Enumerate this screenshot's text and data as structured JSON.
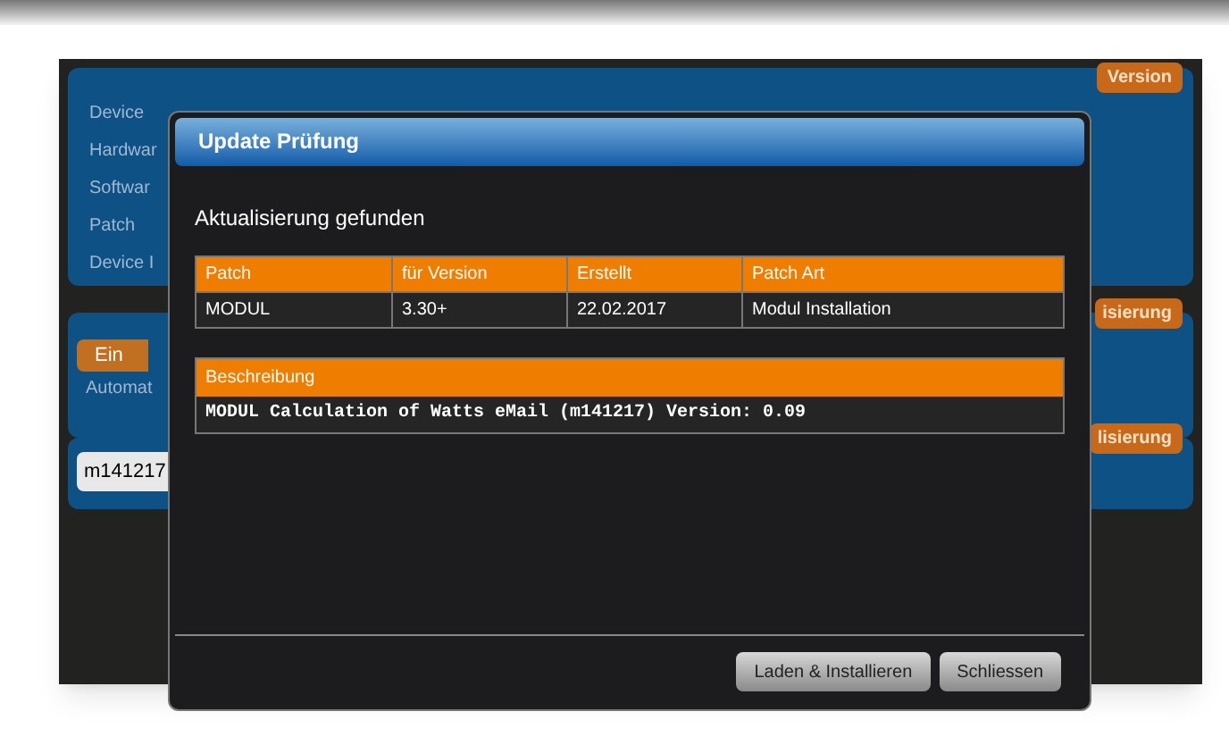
{
  "background": {
    "version_badge": "Version",
    "info_labels": [
      "Device",
      "Hardwar",
      "Softwar",
      "Patch",
      "Device I"
    ],
    "mode_panel": {
      "badge": "isierung",
      "toggle": "Ein",
      "label": "Automat"
    },
    "input_panel": {
      "badge": "lisierung",
      "value": "m141217"
    }
  },
  "dialog": {
    "title": "Update Prüfung",
    "heading": "Aktualisierung gefunden",
    "table": {
      "columns": [
        "Patch",
        "für Version",
        "Erstellt",
        "Patch Art"
      ],
      "rows": [
        [
          "MODUL",
          "3.30+",
          "22.02.2017",
          "Modul Installation"
        ]
      ]
    },
    "description": {
      "heading": "Beschreibung",
      "text": "MODUL Calculation of Watts eMail (m141217) Version: 0.09"
    },
    "buttons": [
      "Laden & Installieren",
      "Schliessen"
    ]
  }
}
